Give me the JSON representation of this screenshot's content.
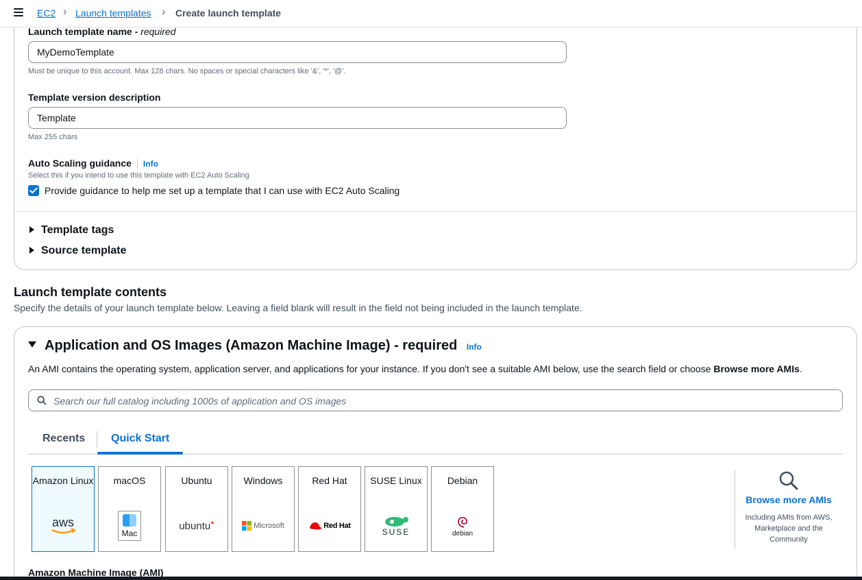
{
  "breadcrumb": {
    "items": [
      "EC2",
      "Launch templates"
    ],
    "current": "Create launch template"
  },
  "form": {
    "name_label": "Launch template name - ",
    "name_required": "required",
    "name_value": "MyDemoTemplate",
    "name_hint": "Must be unique to this account. Max 128 chars. No spaces or special characters like '&', '*', '@'.",
    "desc_label": "Template version description",
    "desc_value": "Template",
    "desc_hint": "Max 255 chars",
    "asg_label": "Auto Scaling guidance",
    "asg_info": "Info",
    "asg_hint": "Select this if you intend to use this template with EC2 Auto Scaling",
    "asg_checkbox_label": "Provide guidance to help me set up a template that I can use with EC2 Auto Scaling",
    "asg_checked": true,
    "tags_label": "Template tags",
    "source_label": "Source template"
  },
  "contents": {
    "title": "Launch template contents",
    "description": "Specify the details of your launch template below. Leaving a field blank will result in the field not being included in the launch template."
  },
  "ami": {
    "title": "Application and OS Images (Amazon Machine Image) - required",
    "info": "Info",
    "description_prefix": "An AMI contains the operating system, application server, and applications for your instance. If you don't see a suitable AMI below, use the search field or choose ",
    "description_bold": "Browse more AMIs",
    "description_suffix": ".",
    "search_placeholder": "Search our full catalog including 1000s of application and OS images",
    "tabs": [
      "Recents",
      "Quick Start"
    ],
    "active_tab": "Quick Start",
    "tiles": [
      {
        "label": "Amazon Linux",
        "logo": "aws-logo",
        "logo_text": "aws"
      },
      {
        "label": "macOS",
        "logo": "mac-logo",
        "logo_text": "Mac"
      },
      {
        "label": "Ubuntu",
        "logo": "ubuntu-logo",
        "logo_text": "ubuntu"
      },
      {
        "label": "Windows",
        "logo": "microsoft-logo",
        "logo_text": "Microsoft"
      },
      {
        "label": "Red Hat",
        "logo": "redhat-logo",
        "logo_text": "Red Hat"
      },
      {
        "label": "SUSE Linux",
        "logo": "suse-logo",
        "logo_text": "SUSE"
      },
      {
        "label": "Debian",
        "logo": "debian-logo",
        "logo_text": "debian"
      }
    ],
    "selected_tile": "Amazon Linux",
    "browse_title": "Browse more AMIs",
    "browse_sub": "Including AMIs from AWS, Marketplace and the Community",
    "ami_label": "Amazon Machine Image (AMI)"
  },
  "colors": {
    "link": "#0972d3",
    "selected_bg": "#f0fbff",
    "checkbox": "#0972d3"
  }
}
